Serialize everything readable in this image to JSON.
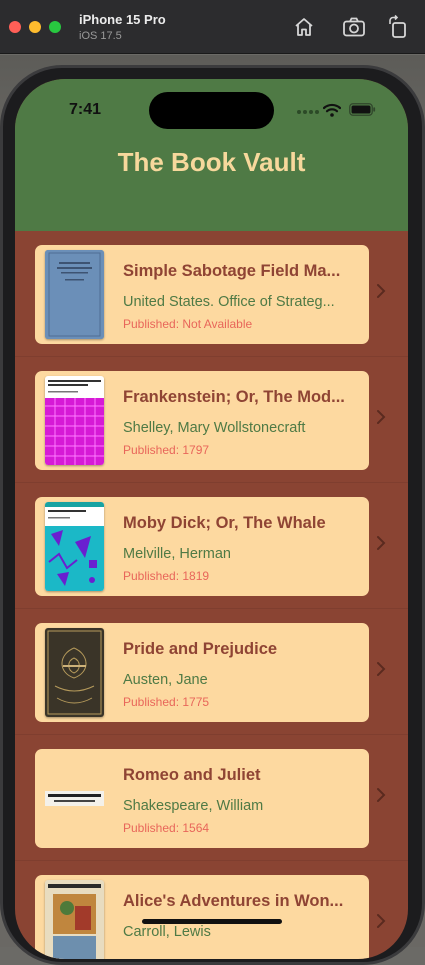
{
  "simulator": {
    "device_name": "iPhone 15 Pro",
    "os_version": "iOS 17.5"
  },
  "status_bar": {
    "time": "7:41"
  },
  "app": {
    "title": "The Book Vault"
  },
  "books": [
    {
      "title": "Simple Sabotage Field Ma...",
      "author": "United States. Office of Strateg...",
      "published": "Published: Not Available"
    },
    {
      "title": "Frankenstein; Or, The Mod...",
      "author": "Shelley, Mary Wollstonecraft",
      "published": "Published: 1797"
    },
    {
      "title": "Moby Dick; Or, The Whale",
      "author": "Melville, Herman",
      "published": "Published: 1819"
    },
    {
      "title": "Pride and Prejudice",
      "author": "Austen, Jane",
      "published": "Published: 1775"
    },
    {
      "title": "Romeo and Juliet",
      "author": "Shakespeare, William",
      "published": "Published: 1564"
    },
    {
      "title": "Alice's Adventures in Won...",
      "author": "Carroll, Lewis",
      "published": ""
    }
  ],
  "colors": {
    "header": "#4f7a45",
    "list_background": "#8a4433",
    "card": "#fdd9a0",
    "title_text": "#8f4434",
    "author_text": "#4f7a45",
    "published_text": "#e8665a"
  }
}
